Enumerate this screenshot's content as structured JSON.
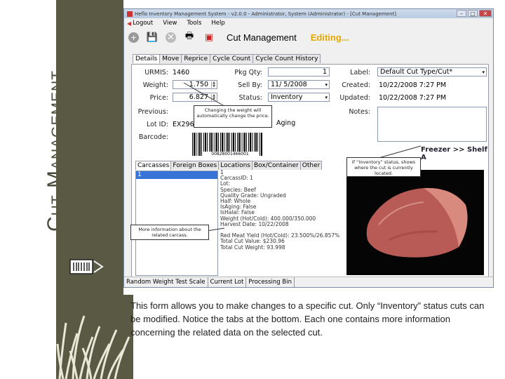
{
  "slide": {
    "title": "Cut Management",
    "caption": "This form allows you to make changes to a specific cut. Only “Inventory” status cuts can be modified. Notice the tabs at the bottom. Each one contains more information concerning the related data on the selected cut."
  },
  "window": {
    "title": "Heflo Inventory Management System - v2.0.0 - Administrator, System (Administrator) - [Cut Management]",
    "menu": [
      "Logout",
      "View",
      "Tools",
      "Help"
    ],
    "screen_title": "Cut Management",
    "editing_label": "Editing...",
    "tabs": [
      "Details",
      "Move",
      "Reprice",
      "Cycle Count",
      "Cycle Count History"
    ],
    "fields": {
      "urmis_label": "URMIS:",
      "urmis": "1460",
      "weight_label": "Weight:",
      "weight": "1.750",
      "price_label": "Price:",
      "price": "6.827",
      "previous_label": "Previous:",
      "lotid_label": "Lot ID:",
      "lotid": "EX296",
      "barcode_label": "Barcode:",
      "barcode_number": "00828001466001",
      "pkgqty_label": "Pkg Qty:",
      "pkgqty": "1",
      "sellby_label": "Sell By:",
      "sellby": "11/ 5/2008",
      "status_label": "Status:",
      "status": "Inventory",
      "aging_text": "Aging",
      "label_label": "Label:",
      "label_value": "Default Cut Type/Cut*",
      "created_label": "Created:",
      "created": "10/22/2008 7:27 PM",
      "updated_label": "Updated:",
      "updated": "10/22/2008 7:27 PM",
      "notes_label": "Notes:",
      "location": "Freezer >> Shelf A"
    },
    "bottom_tabs": [
      "Carcasses",
      "Foreign Boxes",
      "Locations",
      "Box/Container",
      "Other"
    ],
    "list_selected": "1",
    "details_text": "1\nCarcassID: 1\nLot:\nSpecies: Beef\nQuality Grade: Ungraded\nHalf: Whole\nIsAging: False\nIsHalal: False\nWeight (Hot/Cold): 400.000/350.000\nHarvest Date: 10/22/2008\n\nRed Meat Yield (Hot/Cold): 23.500%/26.857%\nTotal Cut Value: $230.96\nTotal Cut Weight: 93.998",
    "status_bar": [
      "Random Weight Test Scale",
      "Current Lot",
      "Processing Bin"
    ]
  },
  "callouts": {
    "weight_note": "Changing the weight will automatically change the price.",
    "status_note": "If “Inventory” status, shows where the cut is currently located.",
    "carcass_note": "More information about the related carcass."
  },
  "colors": {
    "accent": "#e6a800",
    "selection": "#3874d8",
    "slide_bg": "#5a5a44"
  }
}
